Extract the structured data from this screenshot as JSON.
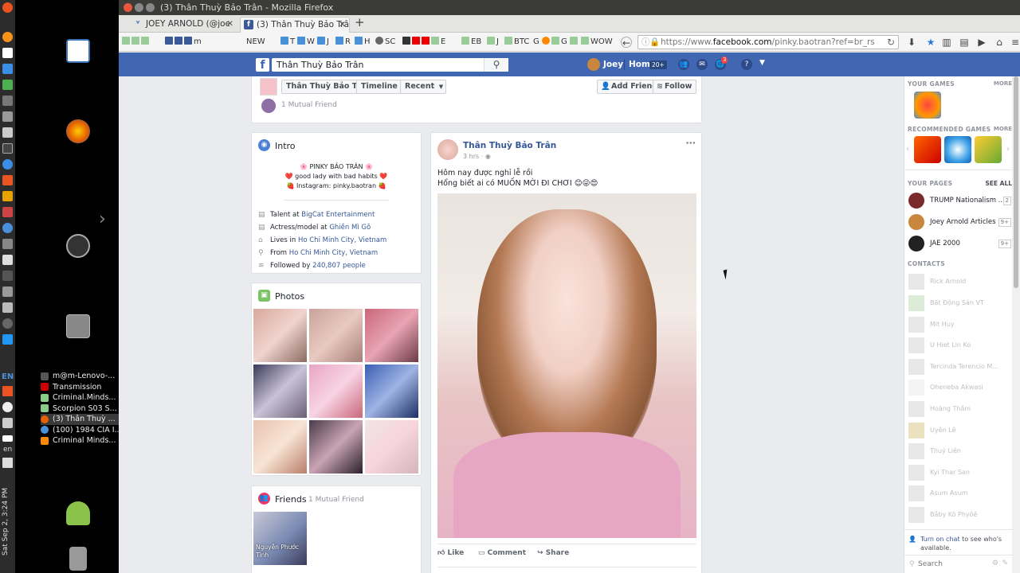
{
  "window": {
    "title": "(3) Thân Thuỳ Bảo Trân - Mozilla Firefox"
  },
  "tabs": [
    {
      "label": "JOEY ARNOLD (@joe"
    },
    {
      "label": "(3) Thân Thuỳ Bảo Trân"
    }
  ],
  "new_tab_label": "+",
  "bookmarks": [
    "m",
    "T",
    "W",
    "J",
    "R",
    "H",
    "SC",
    "NEW",
    "E",
    "EB",
    "J",
    "BTC",
    "G",
    "G",
    "WOW"
  ],
  "url": {
    "prefix": "https://www.",
    "domain": "facebook.com",
    "path": "/pinky.baotran?ref=br_rs"
  },
  "desktop_tasks": [
    "m@m-Lenovo-...",
    "Transmission",
    "Criminal.Minds...",
    "Scorpion S03 S...",
    "(3) Thân Thuỳ ...",
    "(100) 1984 CIA I...",
    "Criminal Minds..."
  ],
  "launcher": {
    "date": "Sat Sep 2, 3:24 PM",
    "lang_short": "EN",
    "lang": "en"
  },
  "fb_header": {
    "logo": "f",
    "search_value": "Thân Thuỳ Bảo Trân",
    "user_name": "Joey",
    "home_label": "Home",
    "home_count": "20+",
    "notif_count": "3"
  },
  "profile_bar": {
    "name": "Thân Thuỳ Bảo Trân",
    "timeline": "Timeline",
    "recent": "Recent",
    "add_friend": "Add Friend",
    "follow": "Follow",
    "mutual": "1 Mutual Friend"
  },
  "intro": {
    "title": "Intro",
    "bio_line1": "🌸 PINKY BẢO TRÂN 🌸",
    "bio_line2": "❤️ good lady with bad habits ❤️",
    "bio_line3": "🍓 Instagram: pinky.baotran 🍓",
    "items": [
      {
        "prefix": "Talent at ",
        "link": "BigCat Entertainment"
      },
      {
        "prefix": "Actress/model at ",
        "link": "Ghiền Mì Gõ"
      },
      {
        "prefix": "Lives in ",
        "link": "Ho Chi Minh City, Vietnam"
      },
      {
        "prefix": "From ",
        "link": "Ho Chi Minh City, Vietnam"
      },
      {
        "prefix": "Followed by ",
        "link": "240,807 people"
      }
    ]
  },
  "photos": {
    "title": "Photos"
  },
  "friends": {
    "title": "Friends",
    "mutual": "1 Mutual Friend",
    "friend_name": "Nguyễn Phước Tình"
  },
  "post": {
    "author": "Thân Thuỳ Bảo Trân",
    "time": "3 hrs",
    "line1": "Hôm nay được nghỉ lễ rồi",
    "line2": "Hổng biết ai có MUỐN MỜI ĐI CHƠI 😊😜😍",
    "like": "Like",
    "comment": "Comment",
    "share": "Share",
    "more": "···"
  },
  "right_sidebar": {
    "your_games": "YOUR GAMES",
    "more": "MORE",
    "recommended_games": "RECOMMENDED GAMES",
    "more2": "MORE",
    "your_pages": "YOUR PAGES",
    "see_all": "SEE ALL",
    "pages": [
      {
        "name": "TRUMP Nationalism ...",
        "count": "2"
      },
      {
        "name": "Joey Arnold Articles",
        "count": "9+"
      },
      {
        "name": "JAE 2000",
        "count": "9+"
      }
    ],
    "contacts_title": "CONTACTS",
    "contacts": [
      "Rick Arnold",
      "Bất Động Sản VT",
      "Mit Huy",
      "U Hiet Lin Ko",
      "Tercinda Terencio M...",
      "Oheneba Akwasi",
      "Hoàng Thắm",
      "Uyên Lê",
      "Thuý Liên",
      "Kyi Thar San",
      "Asum Asum",
      "Bâby Kô Phyôê"
    ],
    "chat_link": "Turn on chat",
    "chat_text": " to see who's available.",
    "search_placeholder": "Search"
  }
}
